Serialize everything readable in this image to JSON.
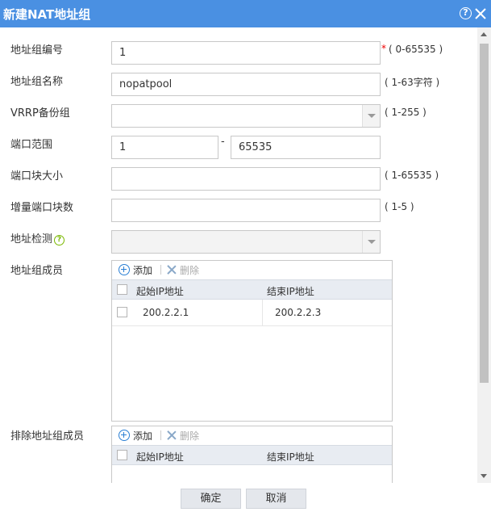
{
  "window": {
    "title": "新建NAT地址组"
  },
  "form": {
    "group_id": {
      "label": "地址组编号",
      "value": "1",
      "required_mark": "*",
      "hint": "( 0-65535 )"
    },
    "group_name": {
      "label": "地址组名称",
      "value": "nopatpool",
      "hint": "( 1-63字符 )"
    },
    "vrrp": {
      "label": "VRRP备份组",
      "value": "",
      "hint": "( 1-255 )"
    },
    "port_range": {
      "label": "端口范围",
      "from": "1",
      "dash": "-",
      "to": "65535"
    },
    "port_block_size": {
      "label": "端口块大小",
      "value": "",
      "hint": "( 1-65535 )"
    },
    "incr_port_blocks": {
      "label": "增量端口块数",
      "value": "",
      "hint": "( 1-5 )"
    },
    "addr_detect": {
      "label": "地址检测",
      "value": ""
    }
  },
  "members": {
    "label": "地址组成员",
    "add_label": "添加",
    "delete_label": "删除",
    "columns": [
      "起始IP地址",
      "结束IP地址"
    ],
    "rows": [
      {
        "start": "200.2.2.1",
        "end": "200.2.2.3"
      }
    ]
  },
  "excluded": {
    "label": "排除地址组成员",
    "add_label": "添加",
    "delete_label": "删除",
    "columns": [
      "起始IP地址",
      "结束IP地址"
    ],
    "rows": []
  },
  "footer": {
    "ok_label": "确定",
    "cancel_label": "取消"
  }
}
